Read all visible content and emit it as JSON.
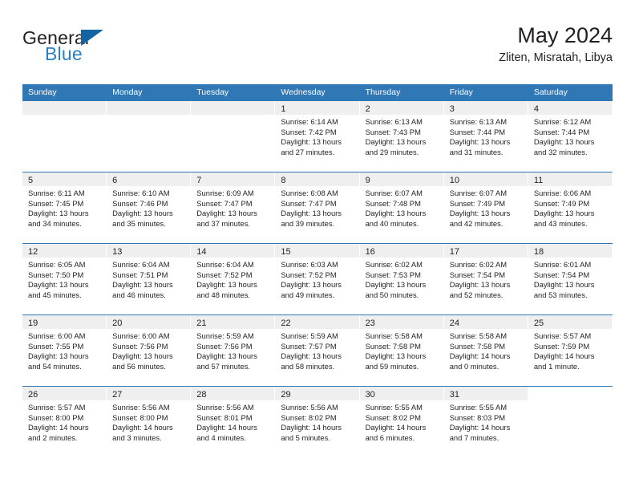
{
  "brand": {
    "name_part1": "General",
    "name_part2": "Blue",
    "flag_icon": "triangle-flag-icon",
    "accent_blue": "#1464a5",
    "text_blue": "#2a7fc4"
  },
  "header": {
    "title": "May 2024",
    "subtitle": "Zliten, Misratah, Libya"
  },
  "theme": {
    "header_band": "#2f77b5",
    "day_band": "#efefef",
    "text": "#231f20"
  },
  "weekdays": [
    "Sunday",
    "Monday",
    "Tuesday",
    "Wednesday",
    "Thursday",
    "Friday",
    "Saturday"
  ],
  "weeks": [
    [
      {
        "day": "",
        "sunrise": "",
        "sunset": "",
        "daylight_1": "",
        "daylight_2": "",
        "empty": true
      },
      {
        "day": "",
        "sunrise": "",
        "sunset": "",
        "daylight_1": "",
        "daylight_2": "",
        "empty": true
      },
      {
        "day": "",
        "sunrise": "",
        "sunset": "",
        "daylight_1": "",
        "daylight_2": "",
        "empty": true
      },
      {
        "day": "1",
        "sunrise": "Sunrise: 6:14 AM",
        "sunset": "Sunset: 7:42 PM",
        "daylight_1": "Daylight: 13 hours",
        "daylight_2": "and 27 minutes."
      },
      {
        "day": "2",
        "sunrise": "Sunrise: 6:13 AM",
        "sunset": "Sunset: 7:43 PM",
        "daylight_1": "Daylight: 13 hours",
        "daylight_2": "and 29 minutes."
      },
      {
        "day": "3",
        "sunrise": "Sunrise: 6:13 AM",
        "sunset": "Sunset: 7:44 PM",
        "daylight_1": "Daylight: 13 hours",
        "daylight_2": "and 31 minutes."
      },
      {
        "day": "4",
        "sunrise": "Sunrise: 6:12 AM",
        "sunset": "Sunset: 7:44 PM",
        "daylight_1": "Daylight: 13 hours",
        "daylight_2": "and 32 minutes."
      }
    ],
    [
      {
        "day": "5",
        "sunrise": "Sunrise: 6:11 AM",
        "sunset": "Sunset: 7:45 PM",
        "daylight_1": "Daylight: 13 hours",
        "daylight_2": "and 34 minutes."
      },
      {
        "day": "6",
        "sunrise": "Sunrise: 6:10 AM",
        "sunset": "Sunset: 7:46 PM",
        "daylight_1": "Daylight: 13 hours",
        "daylight_2": "and 35 minutes."
      },
      {
        "day": "7",
        "sunrise": "Sunrise: 6:09 AM",
        "sunset": "Sunset: 7:47 PM",
        "daylight_1": "Daylight: 13 hours",
        "daylight_2": "and 37 minutes."
      },
      {
        "day": "8",
        "sunrise": "Sunrise: 6:08 AM",
        "sunset": "Sunset: 7:47 PM",
        "daylight_1": "Daylight: 13 hours",
        "daylight_2": "and 39 minutes."
      },
      {
        "day": "9",
        "sunrise": "Sunrise: 6:07 AM",
        "sunset": "Sunset: 7:48 PM",
        "daylight_1": "Daylight: 13 hours",
        "daylight_2": "and 40 minutes."
      },
      {
        "day": "10",
        "sunrise": "Sunrise: 6:07 AM",
        "sunset": "Sunset: 7:49 PM",
        "daylight_1": "Daylight: 13 hours",
        "daylight_2": "and 42 minutes."
      },
      {
        "day": "11",
        "sunrise": "Sunrise: 6:06 AM",
        "sunset": "Sunset: 7:49 PM",
        "daylight_1": "Daylight: 13 hours",
        "daylight_2": "and 43 minutes."
      }
    ],
    [
      {
        "day": "12",
        "sunrise": "Sunrise: 6:05 AM",
        "sunset": "Sunset: 7:50 PM",
        "daylight_1": "Daylight: 13 hours",
        "daylight_2": "and 45 minutes."
      },
      {
        "day": "13",
        "sunrise": "Sunrise: 6:04 AM",
        "sunset": "Sunset: 7:51 PM",
        "daylight_1": "Daylight: 13 hours",
        "daylight_2": "and 46 minutes."
      },
      {
        "day": "14",
        "sunrise": "Sunrise: 6:04 AM",
        "sunset": "Sunset: 7:52 PM",
        "daylight_1": "Daylight: 13 hours",
        "daylight_2": "and 48 minutes."
      },
      {
        "day": "15",
        "sunrise": "Sunrise: 6:03 AM",
        "sunset": "Sunset: 7:52 PM",
        "daylight_1": "Daylight: 13 hours",
        "daylight_2": "and 49 minutes."
      },
      {
        "day": "16",
        "sunrise": "Sunrise: 6:02 AM",
        "sunset": "Sunset: 7:53 PM",
        "daylight_1": "Daylight: 13 hours",
        "daylight_2": "and 50 minutes."
      },
      {
        "day": "17",
        "sunrise": "Sunrise: 6:02 AM",
        "sunset": "Sunset: 7:54 PM",
        "daylight_1": "Daylight: 13 hours",
        "daylight_2": "and 52 minutes."
      },
      {
        "day": "18",
        "sunrise": "Sunrise: 6:01 AM",
        "sunset": "Sunset: 7:54 PM",
        "daylight_1": "Daylight: 13 hours",
        "daylight_2": "and 53 minutes."
      }
    ],
    [
      {
        "day": "19",
        "sunrise": "Sunrise: 6:00 AM",
        "sunset": "Sunset: 7:55 PM",
        "daylight_1": "Daylight: 13 hours",
        "daylight_2": "and 54 minutes."
      },
      {
        "day": "20",
        "sunrise": "Sunrise: 6:00 AM",
        "sunset": "Sunset: 7:56 PM",
        "daylight_1": "Daylight: 13 hours",
        "daylight_2": "and 56 minutes."
      },
      {
        "day": "21",
        "sunrise": "Sunrise: 5:59 AM",
        "sunset": "Sunset: 7:56 PM",
        "daylight_1": "Daylight: 13 hours",
        "daylight_2": "and 57 minutes."
      },
      {
        "day": "22",
        "sunrise": "Sunrise: 5:59 AM",
        "sunset": "Sunset: 7:57 PM",
        "daylight_1": "Daylight: 13 hours",
        "daylight_2": "and 58 minutes."
      },
      {
        "day": "23",
        "sunrise": "Sunrise: 5:58 AM",
        "sunset": "Sunset: 7:58 PM",
        "daylight_1": "Daylight: 13 hours",
        "daylight_2": "and 59 minutes."
      },
      {
        "day": "24",
        "sunrise": "Sunrise: 5:58 AM",
        "sunset": "Sunset: 7:58 PM",
        "daylight_1": "Daylight: 14 hours",
        "daylight_2": "and 0 minutes."
      },
      {
        "day": "25",
        "sunrise": "Sunrise: 5:57 AM",
        "sunset": "Sunset: 7:59 PM",
        "daylight_1": "Daylight: 14 hours",
        "daylight_2": "and 1 minute."
      }
    ],
    [
      {
        "day": "26",
        "sunrise": "Sunrise: 5:57 AM",
        "sunset": "Sunset: 8:00 PM",
        "daylight_1": "Daylight: 14 hours",
        "daylight_2": "and 2 minutes."
      },
      {
        "day": "27",
        "sunrise": "Sunrise: 5:56 AM",
        "sunset": "Sunset: 8:00 PM",
        "daylight_1": "Daylight: 14 hours",
        "daylight_2": "and 3 minutes."
      },
      {
        "day": "28",
        "sunrise": "Sunrise: 5:56 AM",
        "sunset": "Sunset: 8:01 PM",
        "daylight_1": "Daylight: 14 hours",
        "daylight_2": "and 4 minutes."
      },
      {
        "day": "29",
        "sunrise": "Sunrise: 5:56 AM",
        "sunset": "Sunset: 8:02 PM",
        "daylight_1": "Daylight: 14 hours",
        "daylight_2": "and 5 minutes."
      },
      {
        "day": "30",
        "sunrise": "Sunrise: 5:55 AM",
        "sunset": "Sunset: 8:02 PM",
        "daylight_1": "Daylight: 14 hours",
        "daylight_2": "and 6 minutes."
      },
      {
        "day": "31",
        "sunrise": "Sunrise: 5:55 AM",
        "sunset": "Sunset: 8:03 PM",
        "daylight_1": "Daylight: 14 hours",
        "daylight_2": "and 7 minutes."
      },
      {
        "day": "",
        "sunrise": "",
        "sunset": "",
        "daylight_1": "",
        "daylight_2": "",
        "empty": true,
        "noband": true
      }
    ]
  ]
}
